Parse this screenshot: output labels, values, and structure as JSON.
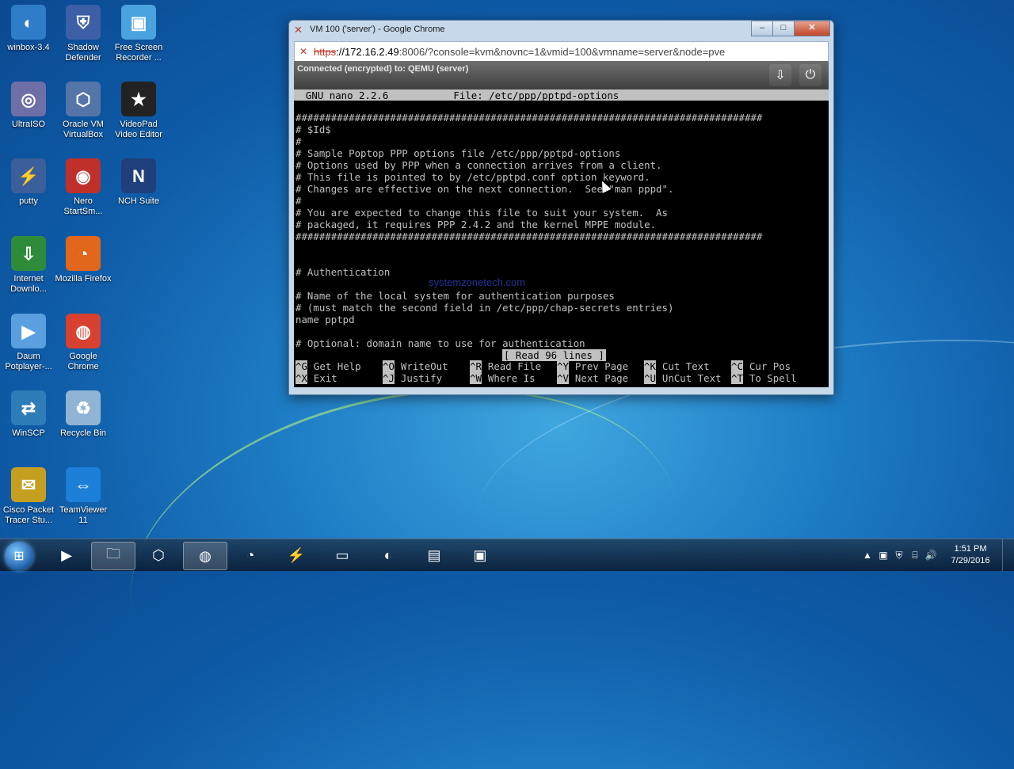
{
  "desktop_icons": [
    {
      "label": "winbox-3.4",
      "icon": "winbox-icon",
      "color": "#2f7dc8",
      "glyph": "◐"
    },
    {
      "label": "Shadow Defender",
      "icon": "shadow-defender-icon",
      "color": "#3c5fa8",
      "glyph": "⛨"
    },
    {
      "label": "Free Screen Recorder ...",
      "icon": "free-screen-recorder-icon",
      "color": "#4aa3df",
      "glyph": "▣"
    },
    {
      "label": "UltraISO",
      "icon": "ultraiso-icon",
      "color": "#6f6fa8",
      "glyph": "◎"
    },
    {
      "label": "Oracle VM VirtualBox",
      "icon": "virtualbox-icon",
      "color": "#5574a8",
      "glyph": "⬡"
    },
    {
      "label": "VideoPad Video Editor",
      "icon": "videopad-icon",
      "color": "#222222",
      "glyph": "★"
    },
    {
      "label": "putty",
      "icon": "putty-icon",
      "color": "#3a5f9a",
      "glyph": "⚡"
    },
    {
      "label": "Nero StartSm...",
      "icon": "nero-icon",
      "color": "#c0302a",
      "glyph": "◉"
    },
    {
      "label": "NCH Suite",
      "icon": "nch-suite-icon",
      "color": "#1e3f7a",
      "glyph": "N"
    },
    {
      "label": "Internet Downlo...",
      "icon": "internet-download-manager-icon",
      "color": "#2e8b3a",
      "glyph": "⇩"
    },
    {
      "label": "Mozilla Firefox",
      "icon": "firefox-icon",
      "color": "#e2661b",
      "glyph": "◔"
    },
    {
      "label": "Daum Potplayer-...",
      "icon": "potplayer-icon",
      "color": "#5aa0e0",
      "glyph": "▶"
    },
    {
      "label": "Google Chrome",
      "icon": "chrome-icon",
      "color": "#d8402f",
      "glyph": "◍"
    },
    {
      "label": "WinSCP",
      "icon": "winscp-icon",
      "color": "#2e7db8",
      "glyph": "⇄"
    },
    {
      "label": "Recycle Bin",
      "icon": "recycle-bin-icon",
      "color": "#8fb4d4",
      "glyph": "♻"
    },
    {
      "label": "Cisco Packet Tracer Stu...",
      "icon": "cisco-packet-tracer-icon",
      "color": "#c5a020",
      "glyph": "✉"
    },
    {
      "label": "TeamViewer 11",
      "icon": "teamviewer-icon",
      "color": "#1c7fd8",
      "glyph": "⇔"
    }
  ],
  "browser": {
    "title": "VM 100 ('server') - Google Chrome",
    "url_scheme": "https",
    "url_host": "://172.16.2.49",
    "url_rest": ":8006/?console=kvm&novnc=1&vmid=100&vmname=server&node=pve",
    "minimize": "–",
    "maximize": "□",
    "close": "✕"
  },
  "novnc": {
    "status": "Connected (encrypted) to: QEMU (server)"
  },
  "terminal": {
    "header": "  GNU nano 2.2.6           File: /etc/ppp/pptpd-options",
    "lines": [
      "###############################################################################",
      "# $Id$",
      "#",
      "# Sample Poptop PPP options file /etc/ppp/pptpd-options",
      "# Options used by PPP when a connection arrives from a client.",
      "# This file is pointed to by /etc/pptpd.conf option keyword.",
      "# Changes are effective on the next connection.  See \"man pppd\".",
      "#",
      "# You are expected to change this file to suit your system.  As",
      "# packaged, it requires PPP 2.4.2 and the kernel MPPE module.",
      "###############################################################################",
      "",
      "",
      "# Authentication",
      "",
      "# Name of the local system for authentication purposes",
      "# (must match the second field in /etc/ppp/chap-secrets entries)",
      "name pptpd",
      "",
      "# Optional: domain name to use for authentication"
    ],
    "status_message": "[ Read 96 lines ]",
    "watermark": "systemzonetech.com",
    "shortcuts_row1": [
      {
        "key": "^G",
        "label": "Get Help"
      },
      {
        "key": "^O",
        "label": "WriteOut"
      },
      {
        "key": "^R",
        "label": "Read File"
      },
      {
        "key": "^Y",
        "label": "Prev Page"
      },
      {
        "key": "^K",
        "label": "Cut Text"
      },
      {
        "key": "^C",
        "label": "Cur Pos"
      }
    ],
    "shortcuts_row2": [
      {
        "key": "^X",
        "label": "Exit"
      },
      {
        "key": "^J",
        "label": "Justify"
      },
      {
        "key": "^W",
        "label": "Where Is"
      },
      {
        "key": "^V",
        "label": "Next Page"
      },
      {
        "key": "^U",
        "label": "UnCut Text"
      },
      {
        "key": "^T",
        "label": "To Spell"
      }
    ]
  },
  "taskbar": {
    "items": [
      {
        "name": "media-player",
        "icon": "media-player-icon",
        "glyph": "▶",
        "active": false
      },
      {
        "name": "file-explorer",
        "icon": "folder-icon",
        "glyph": "🗀",
        "active": true
      },
      {
        "name": "virtualbox",
        "icon": "virtualbox-icon",
        "glyph": "⬡",
        "active": false
      },
      {
        "name": "chrome",
        "icon": "chrome-icon",
        "glyph": "◍",
        "active": true
      },
      {
        "name": "firefox",
        "icon": "firefox-icon",
        "glyph": "◔",
        "active": false
      },
      {
        "name": "putty",
        "icon": "putty-icon",
        "glyph": "⚡",
        "active": false
      },
      {
        "name": "cmd",
        "icon": "terminal-icon",
        "glyph": "▭",
        "active": false
      },
      {
        "name": "winbox",
        "icon": "winbox-icon",
        "glyph": "◐",
        "active": false
      },
      {
        "name": "notepad",
        "icon": "notepad-icon",
        "glyph": "▤",
        "active": false
      },
      {
        "name": "screen-recorder",
        "icon": "screen-recorder-icon",
        "glyph": "▣",
        "active": false
      }
    ],
    "clock_time": "1:51 PM",
    "clock_date": "7/29/2016"
  }
}
